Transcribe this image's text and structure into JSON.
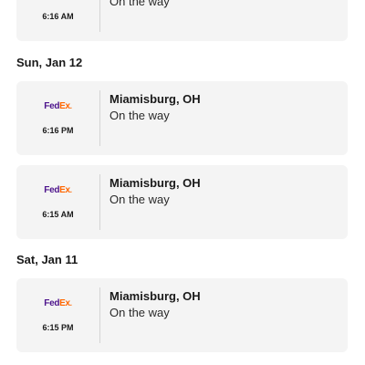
{
  "carrier_logo": {
    "fed": "Fed",
    "ex": "Ex",
    "dot": ".",
    "colors": {
      "fed": "#4d148c",
      "ex": "#ff6600"
    }
  },
  "first_card": {
    "time": "6:16 AM",
    "status": "On the way"
  },
  "groups": [
    {
      "date": "Sun, Jan 12",
      "events": [
        {
          "time": "6:16 PM",
          "city": "Miamisburg, OH",
          "status": "On the way"
        },
        {
          "time": "6:15 AM",
          "city": "Miamisburg, OH",
          "status": "On the way"
        }
      ]
    },
    {
      "date": "Sat, Jan 11",
      "events": [
        {
          "time": "6:15 PM",
          "city": "Miamisburg, OH",
          "status": "On the way"
        }
      ]
    }
  ]
}
